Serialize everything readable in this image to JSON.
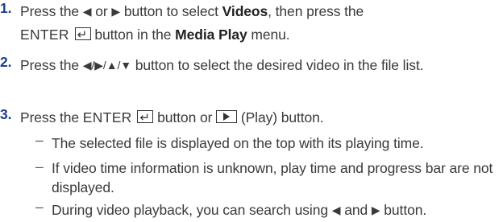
{
  "steps": [
    {
      "number": "1.",
      "part1": "Press the",
      "left_arrow": "◀",
      "or": "or",
      "right_arrow": "▶",
      "part2": "button to select",
      "videos": "Videos",
      "part3": ", then press the",
      "enter": "ENTER",
      "part4": "button in the",
      "media_play": "Media Play",
      "part5": "menu."
    },
    {
      "number": "2.",
      "part1": "Press the",
      "arrows": "◀/▶/▲/▼",
      "part2": "button to select the desired video in the file list."
    },
    {
      "number": "3.",
      "part1": "Press the",
      "enter": "ENTER",
      "part2": "button or",
      "part3": "(Play) button."
    }
  ],
  "bullets": [
    {
      "dash": "–",
      "text": "The selected file is displayed on the top with its playing time."
    },
    {
      "dash": "–",
      "text": "If video time information is unknown, play time and progress bar are not displayed."
    },
    {
      "dash": "–",
      "part1": "During video playback, you can search using",
      "left_arrow": "◀",
      "and": "and",
      "right_arrow": "▶",
      "part2": "button."
    }
  ]
}
